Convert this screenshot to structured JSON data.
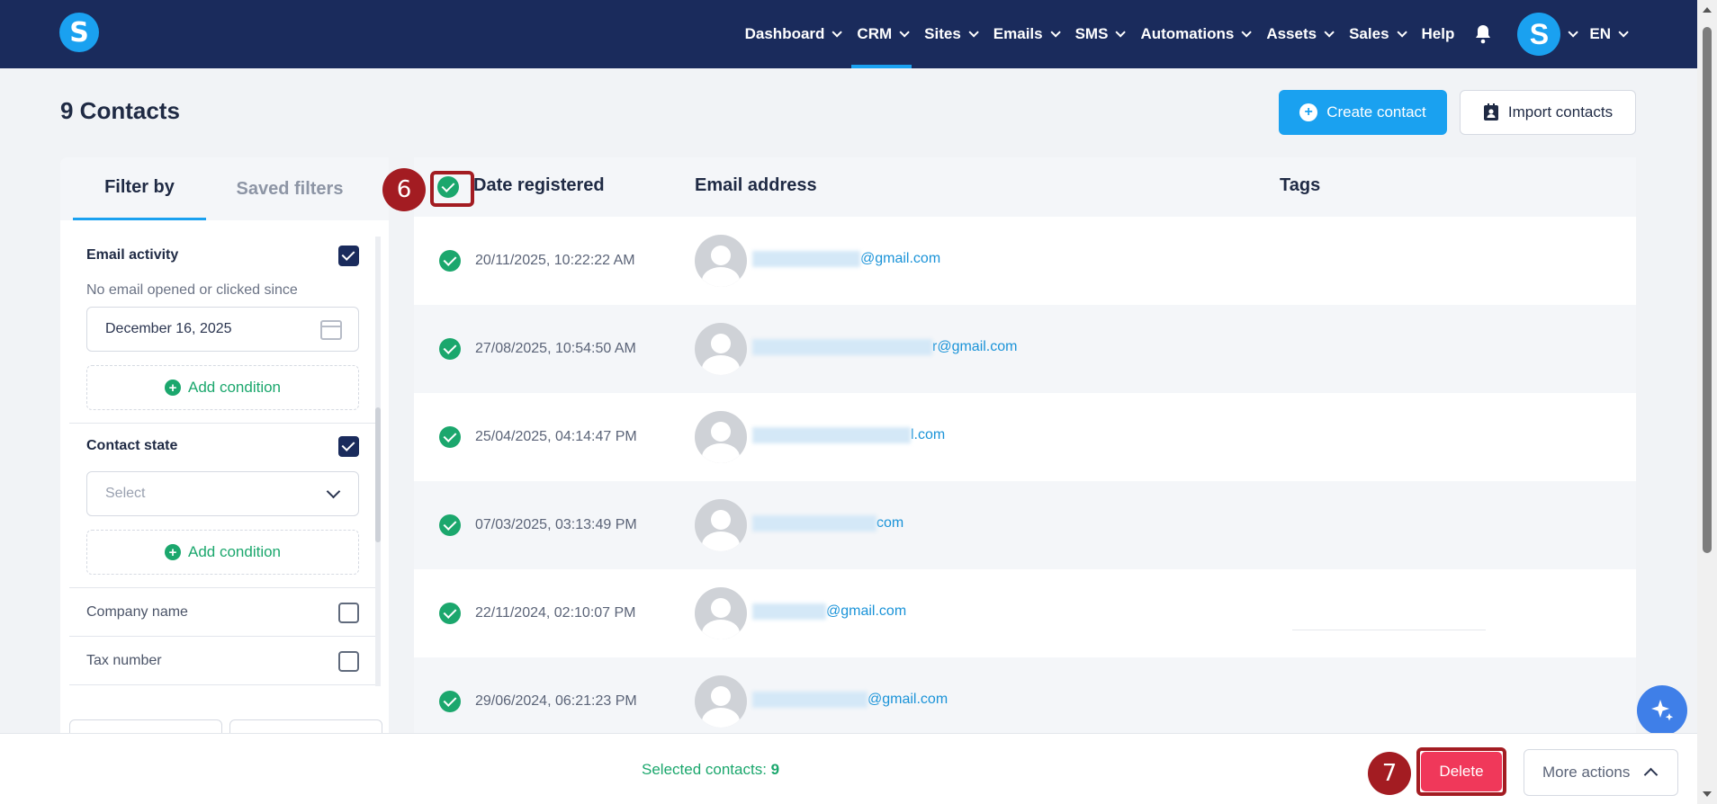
{
  "nav": {
    "logo_letter": "S",
    "items": [
      {
        "label": "Dashboard",
        "chevron": true
      },
      {
        "label": "CRM",
        "chevron": true,
        "active": true
      },
      {
        "label": "Sites",
        "chevron": true
      },
      {
        "label": "Emails",
        "chevron": true
      },
      {
        "label": "SMS",
        "chevron": true
      },
      {
        "label": "Automations",
        "chevron": true
      },
      {
        "label": "Assets",
        "chevron": true
      },
      {
        "label": "Sales",
        "chevron": true
      },
      {
        "label": "Help",
        "chevron": false
      }
    ],
    "avatar_letter": "S",
    "language": "EN"
  },
  "page": {
    "title": "9 Contacts",
    "create_label": "Create contact",
    "import_label": "Import contacts"
  },
  "filters": {
    "tab_active": "Filter by",
    "tab_inactive": "Saved filters",
    "email_activity": {
      "title": "Email activity",
      "checked": true,
      "description": "No email opened or clicked since",
      "date_value": "December 16, 2025"
    },
    "add_condition": "Add condition",
    "contact_state": {
      "title": "Contact state",
      "checked": true,
      "select_placeholder": "Select"
    },
    "company_name": "Company name",
    "tax_number": "Tax number"
  },
  "table": {
    "columns": {
      "date": "Date registered",
      "email": "Email address",
      "tags": "Tags"
    },
    "rows": [
      {
        "date": "20/11/2025, 10:22:22 AM",
        "email_visible": "@gmail.com"
      },
      {
        "date": "27/08/2025, 10:54:50 AM",
        "email_visible": "r@gmail.com"
      },
      {
        "date": "25/04/2025, 04:14:47 PM",
        "email_visible": "l.com"
      },
      {
        "date": "07/03/2025, 03:13:49 PM",
        "email_visible": "com"
      },
      {
        "date": "22/11/2024, 02:10:07 PM",
        "email_visible": "@gmail.com"
      },
      {
        "date": "29/06/2024, 06:21:23 PM",
        "email_visible": "@gmail.com"
      }
    ]
  },
  "steps": {
    "six": "6",
    "seven": "7"
  },
  "bottom": {
    "selected_label": "Selected contacts:",
    "selected_count": "9",
    "delete_label": "Delete",
    "more_label": "More actions"
  },
  "colors": {
    "nav_bg": "#1a2b5c",
    "accent": "#1aa1f0",
    "success": "#1ba76d",
    "danger": "#f0385a",
    "step_badge": "#a31c22"
  },
  "icons": {
    "bell": "bell-icon",
    "calendar": "calendar-icon",
    "sparkle": "sparkle-icon"
  }
}
